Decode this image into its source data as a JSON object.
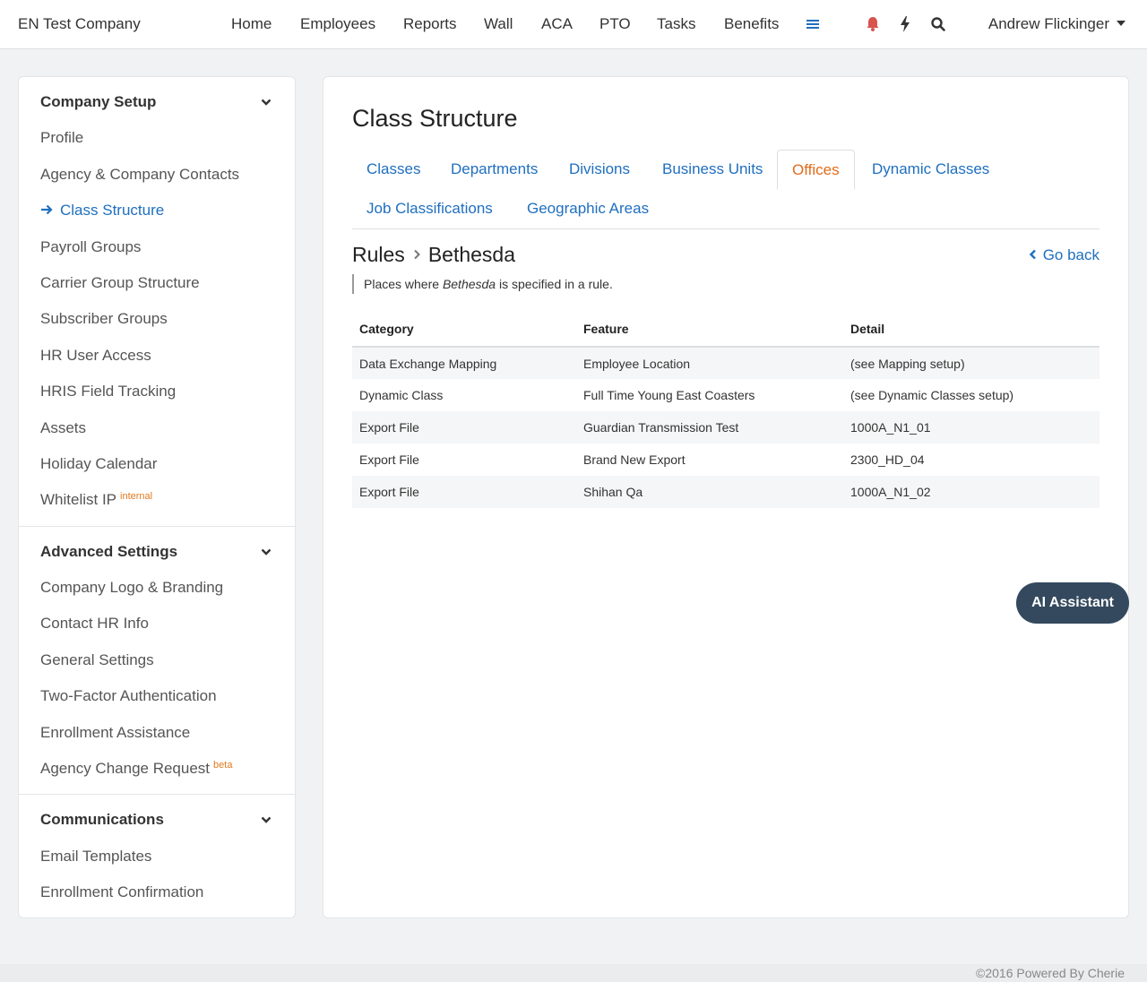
{
  "header": {
    "brand": "EN Test Company",
    "nav": [
      "Home",
      "Employees",
      "Reports",
      "Wall",
      "ACA",
      "PTO",
      "Tasks",
      "Benefits"
    ],
    "user": "Andrew Flickinger",
    "icons": [
      "menu-icon",
      "bell-icon",
      "bolt-icon",
      "search-icon"
    ],
    "colors": {
      "menu_icon": "#1f6fbf",
      "bell_icon": "#d9534f"
    }
  },
  "sidebar": {
    "company_setup": {
      "title": "Company Setup",
      "items": [
        "Profile",
        "Agency & Company Contacts",
        "Class Structure",
        "Payroll Groups",
        "Carrier Group Structure",
        "Subscriber Groups",
        "HR User Access",
        "HRIS Field Tracking",
        "Assets",
        "Holiday Calendar",
        "Whitelist IP"
      ],
      "whitelist_tag": "internal",
      "active": "Class Structure"
    },
    "advanced_settings": {
      "title": "Advanced Settings",
      "items": [
        "Company Logo & Branding",
        "Contact HR Info",
        "General Settings",
        "Two-Factor Authentication",
        "Enrollment Assistance",
        "Agency Change Request"
      ],
      "agency_tag": "beta"
    },
    "communications": {
      "title": "Communications",
      "items": [
        "Email Templates",
        "Enrollment Confirmation"
      ]
    }
  },
  "main": {
    "title": "Class Structure",
    "tabs": [
      "Classes",
      "Departments",
      "Divisions",
      "Business Units",
      "Offices",
      "Dynamic Classes",
      "Job Classifications",
      "Geographic Areas"
    ],
    "active_tab": "Offices",
    "breadcrumb": {
      "parent": "Rules",
      "current": "Bethesda"
    },
    "go_back": "Go back",
    "note": {
      "prefix": "Places where ",
      "emphasis": "Bethesda",
      "suffix": " is specified in a rule."
    },
    "table": {
      "headers": [
        "Category",
        "Feature",
        "Detail"
      ],
      "rows": [
        [
          "Data Exchange Mapping",
          "Employee Location",
          "(see Mapping setup)"
        ],
        [
          "Dynamic Class",
          "Full Time Young East Coasters",
          "(see Dynamic Classes setup)"
        ],
        [
          "Export File",
          "Guardian Transmission Test",
          "1000A_N1_01"
        ],
        [
          "Export File",
          "Brand New Export",
          "2300_HD_04"
        ],
        [
          "Export File",
          "Shihan Qa",
          "1000A_N1_02"
        ]
      ]
    }
  },
  "ai_assistant": "AI Assistant",
  "footer": "©2016 Powered By Cherie"
}
